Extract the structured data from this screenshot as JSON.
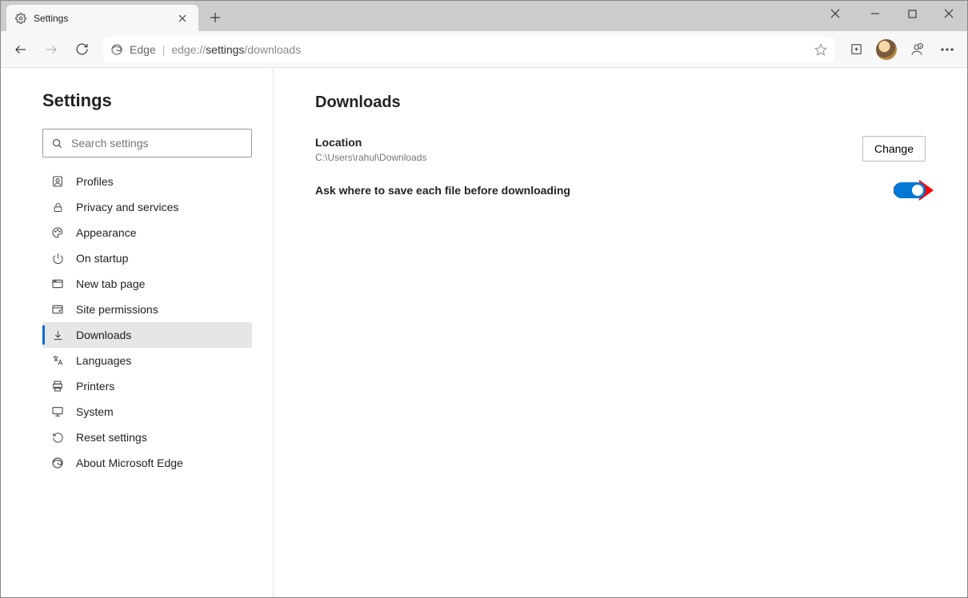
{
  "tab": {
    "title": "Settings"
  },
  "address": {
    "site_label": "Edge",
    "url_prefix": "edge://",
    "url_bold": "settings",
    "url_suffix": "/downloads"
  },
  "sidebar": {
    "title": "Settings",
    "search_placeholder": "Search settings",
    "items": [
      {
        "label": "Profiles"
      },
      {
        "label": "Privacy and services"
      },
      {
        "label": "Appearance"
      },
      {
        "label": "On startup"
      },
      {
        "label": "New tab page"
      },
      {
        "label": "Site permissions"
      },
      {
        "label": "Downloads"
      },
      {
        "label": "Languages"
      },
      {
        "label": "Printers"
      },
      {
        "label": "System"
      },
      {
        "label": "Reset settings"
      },
      {
        "label": "About Microsoft Edge"
      }
    ]
  },
  "main": {
    "title": "Downloads",
    "location_label": "Location",
    "location_path": "C:\\Users\\rahul\\Downloads",
    "change_label": "Change",
    "ask_label": "Ask where to save each file before downloading",
    "ask_toggle_on": true
  }
}
